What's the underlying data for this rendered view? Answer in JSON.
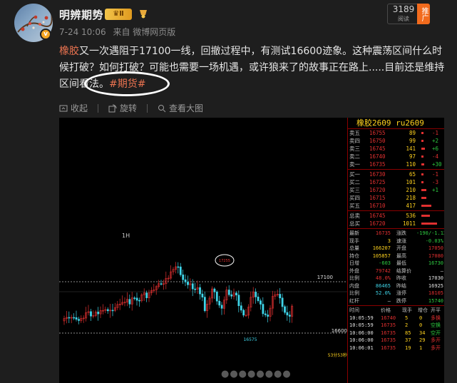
{
  "user": {
    "name": "明辨期势",
    "vip_level": "Ⅱ",
    "meta_time": "7-24 10:06",
    "meta_source": "来自 微博网页版"
  },
  "views": {
    "count": "3189",
    "label": "阅读"
  },
  "promote": "推广",
  "post": {
    "tag_link": "橡胶",
    "text1": "又一次遇阻于17100一线，回撤过程中，有测试16600迹象。这种震荡区间什么时候打破？如何打破？可能也需要一场机遇，或许狼来了的故事正在路上.....目前还是维持区间看法。",
    "hashtag": "#期货#"
  },
  "actions": {
    "collapse": "收起",
    "rotate": "旋转",
    "view_large": "查看大图"
  },
  "chart": {
    "title": "橡胶2609  ru2609",
    "timeframe": "1H",
    "price_high": "17100",
    "price_low": "16600",
    "low_label": "16575",
    "high_label": "17255",
    "bottom_label": "53分53秒"
  },
  "orderbook": {
    "asks": [
      {
        "label": "卖五",
        "price": "16755",
        "vol": "89",
        "chg": "-1"
      },
      {
        "label": "卖四",
        "price": "16750",
        "vol": "99",
        "chg": "+2"
      },
      {
        "label": "卖三",
        "price": "16745",
        "vol": "141",
        "chg": "+6"
      },
      {
        "label": "卖二",
        "price": "16740",
        "vol": "97",
        "chg": "-4"
      },
      {
        "label": "卖一",
        "price": "16735",
        "vol": "110",
        "chg": "+30"
      }
    ],
    "bids": [
      {
        "label": "买一",
        "price": "16730",
        "vol": "65",
        "chg": "-1"
      },
      {
        "label": "买二",
        "price": "16725",
        "vol": "101",
        "chg": "-3"
      },
      {
        "label": "买三",
        "price": "16720",
        "vol": "210",
        "chg": "+1"
      },
      {
        "label": "买四",
        "price": "16715",
        "vol": "218",
        "chg": ""
      },
      {
        "label": "买五",
        "price": "16710",
        "vol": "417",
        "chg": ""
      }
    ],
    "total_ask": {
      "label": "总卖",
      "price": "16745",
      "vol": "536"
    },
    "total_bid": {
      "label": "总买",
      "price": "16720",
      "vol": "1011"
    }
  },
  "stats": [
    {
      "k1": "最新",
      "v1": "16735",
      "k2": "涨跌",
      "v2": "-190/-1.12%"
    },
    {
      "k1": "现手",
      "v1": "3",
      "k2": "速涨",
      "v2": "-0.03%"
    },
    {
      "k1": "总量",
      "v1": "166207",
      "k2": "开盘",
      "v2": "17050"
    },
    {
      "k1": "持仓",
      "v1": "105857",
      "k2": "最高",
      "v2": "17080"
    },
    {
      "k1": "日增",
      "v1": "-603",
      "k2": "最低",
      "v2": "16730"
    },
    {
      "k1": "外盘",
      "v1": "79742",
      "k2": "结算价",
      "v2": "—"
    },
    {
      "k1": "比例",
      "v1": "48.0%",
      "k2": "昨收",
      "v2": "17030"
    },
    {
      "k1": "内盘",
      "v1": "86465",
      "k2": "昨结",
      "v2": "16925"
    },
    {
      "k1": "比例",
      "v1": "52.0%",
      "k2": "涨停",
      "v2": "18105"
    },
    {
      "k1": "红杆",
      "v1": "—",
      "k2": "跌停",
      "v2": "15740"
    }
  ],
  "trades_header": {
    "time": "时间",
    "price": "价格",
    "vol": "现手",
    "oi": "增仓",
    "type": "开平"
  },
  "trades": [
    {
      "time": "10:05:59",
      "price": "16740",
      "vol": "5",
      "oi": "0",
      "type": "多换"
    },
    {
      "time": "10:05:59",
      "price": "16735",
      "vol": "2",
      "oi": "0",
      "type": "空换"
    },
    {
      "time": "10:06:00",
      "price": "16735",
      "vol": "85",
      "oi": "34",
      "type": "空开"
    },
    {
      "time": "10:06:00",
      "price": "16735",
      "vol": "37",
      "oi": "29",
      "type": "多开"
    },
    {
      "time": "10:06:01",
      "price": "16735",
      "vol": "19",
      "oi": "1",
      "type": "多开"
    }
  ]
}
